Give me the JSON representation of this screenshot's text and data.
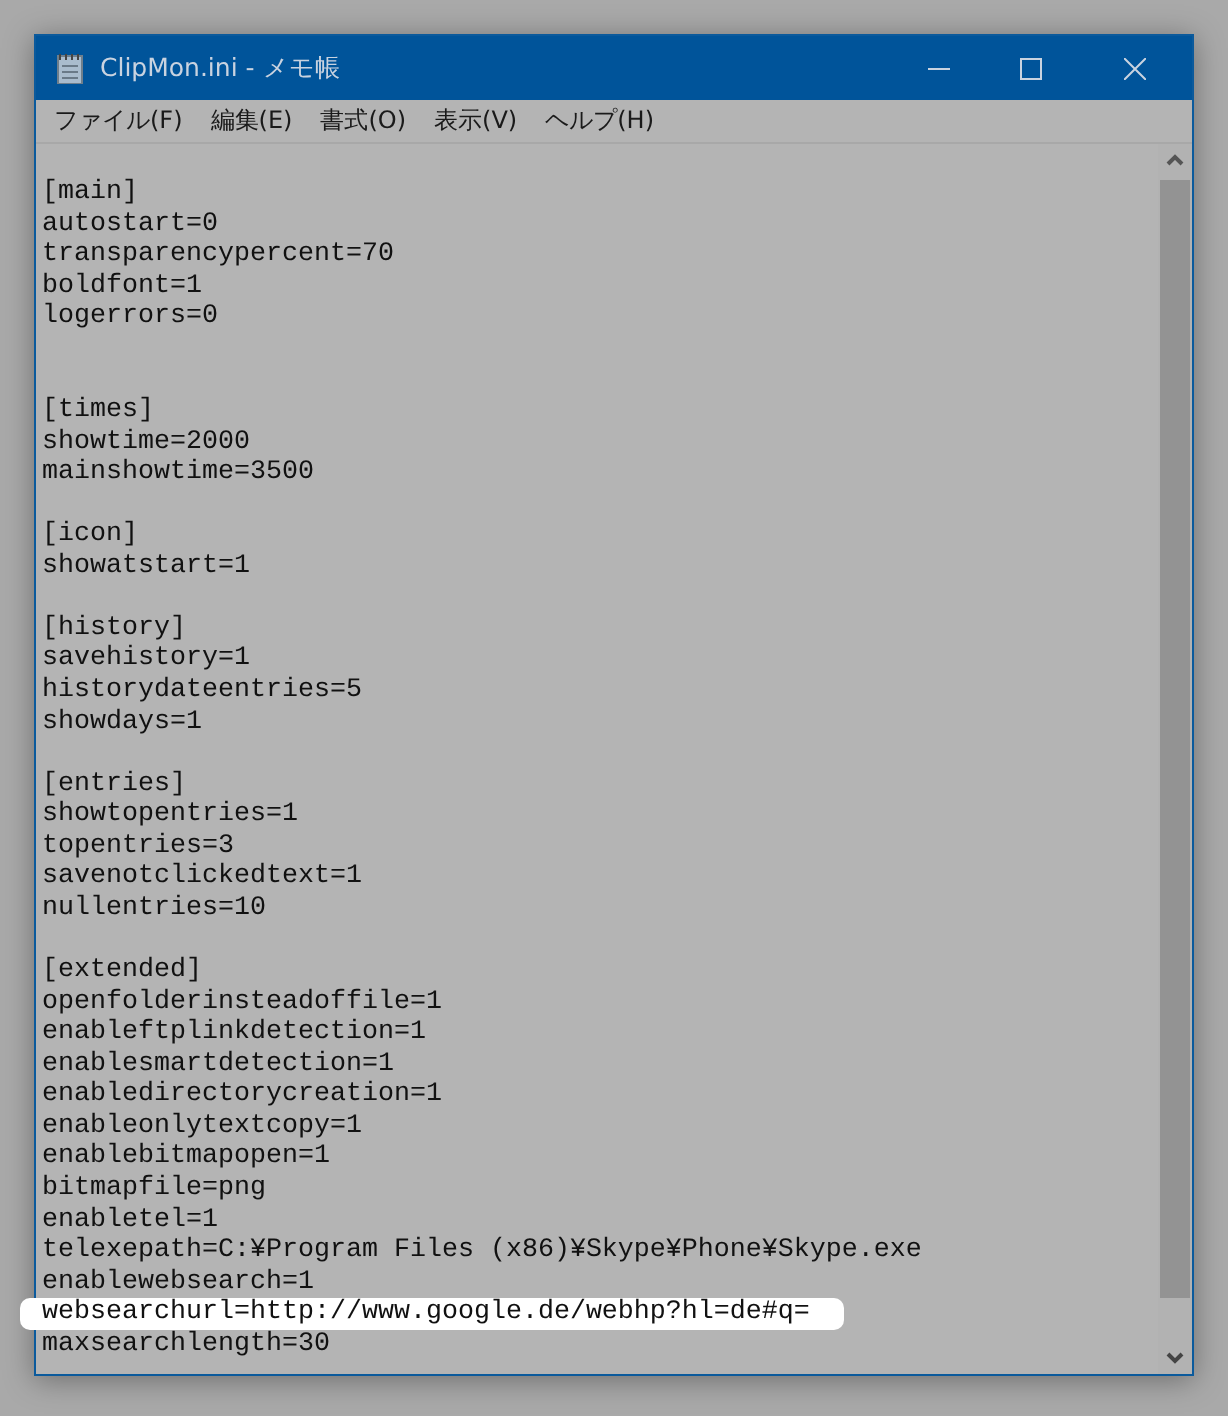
{
  "window": {
    "title": "ClipMon.ini - メモ帳"
  },
  "menu": [
    "ファイル(F)",
    "編集(E)",
    "書式(O)",
    "表示(V)",
    "ヘルプ(H)"
  ],
  "lines": [
    {
      "kind": "text",
      "text": "[main]",
      "highlighted": false
    },
    {
      "kind": "text",
      "text": "autostart=0",
      "highlighted": false
    },
    {
      "kind": "text",
      "text": "transparencypercent=70",
      "highlighted": false
    },
    {
      "kind": "text",
      "text": "boldfont=1",
      "highlighted": false
    },
    {
      "kind": "text",
      "text": "logerrors=0",
      "highlighted": false
    },
    {
      "kind": "blank"
    },
    {
      "kind": "blank"
    },
    {
      "kind": "text",
      "text": "[times]",
      "highlighted": false
    },
    {
      "kind": "text",
      "text": "showtime=2000",
      "highlighted": false
    },
    {
      "kind": "text",
      "text": "mainshowtime=3500",
      "highlighted": false
    },
    {
      "kind": "blank"
    },
    {
      "kind": "text",
      "text": "[icon]",
      "highlighted": false
    },
    {
      "kind": "text",
      "text": "showatstart=1",
      "highlighted": false
    },
    {
      "kind": "blank"
    },
    {
      "kind": "text",
      "text": "[history]",
      "highlighted": false
    },
    {
      "kind": "text",
      "text": "savehistory=1",
      "highlighted": false
    },
    {
      "kind": "text",
      "text": "historydateentries=5",
      "highlighted": false
    },
    {
      "kind": "text",
      "text": "showdays=1",
      "highlighted": false
    },
    {
      "kind": "blank"
    },
    {
      "kind": "text",
      "text": "[entries]",
      "highlighted": false
    },
    {
      "kind": "text",
      "text": "showtopentries=1",
      "highlighted": false
    },
    {
      "kind": "text",
      "text": "topentries=3",
      "highlighted": false
    },
    {
      "kind": "text",
      "text": "savenotclickedtext=1",
      "highlighted": false
    },
    {
      "kind": "text",
      "text": "nullentries=10",
      "highlighted": false
    },
    {
      "kind": "blank"
    },
    {
      "kind": "text",
      "text": "[extended]",
      "highlighted": false
    },
    {
      "kind": "text",
      "text": "openfolderinsteadoffile=1",
      "highlighted": false
    },
    {
      "kind": "text",
      "text": "enableftplinkdetection=1",
      "highlighted": false
    },
    {
      "kind": "text",
      "text": "enablesmartdetection=1",
      "highlighted": false
    },
    {
      "kind": "text",
      "text": "enabledirectorycreation=1",
      "highlighted": false
    },
    {
      "kind": "text",
      "text": "enableonlytextcopy=1",
      "highlighted": false
    },
    {
      "kind": "text",
      "text": "enablebitmapopen=1",
      "highlighted": false
    },
    {
      "kind": "text",
      "text": "bitmapfile=png",
      "highlighted": false
    },
    {
      "kind": "text",
      "text": "enabletel=1",
      "highlighted": false
    },
    {
      "kind": "text",
      "text": "telexepath=C:¥Program Files (x86)¥Skype¥Phone¥Skype.exe",
      "highlighted": false
    },
    {
      "kind": "text",
      "text": "enablewebsearch=1",
      "highlighted": false
    },
    {
      "kind": "text",
      "text": "websearchurl=http://www.google.de/webhp?hl=de#q=",
      "highlighted": true
    },
    {
      "kind": "text",
      "text": "maxsearchlength=30",
      "highlighted": false
    }
  ]
}
